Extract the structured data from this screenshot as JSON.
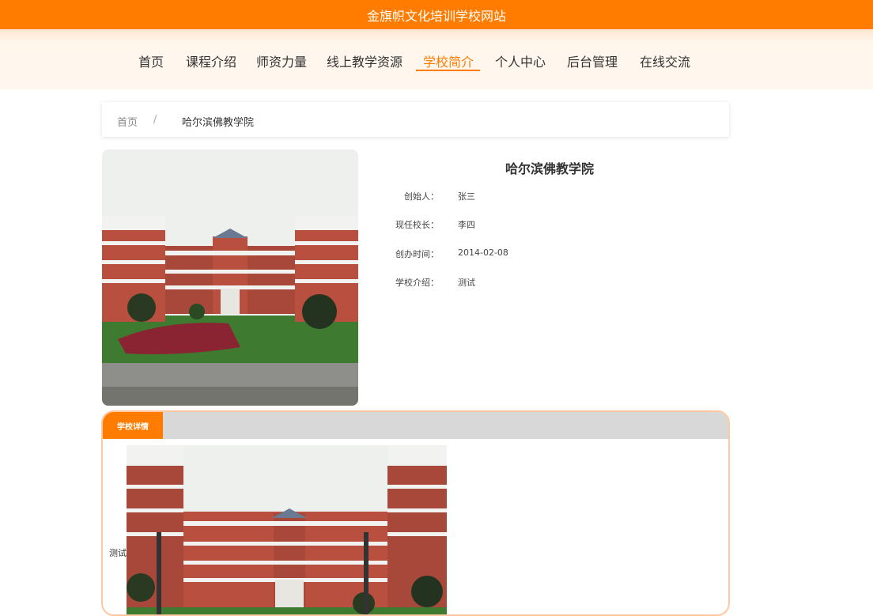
{
  "site": {
    "title": "金旗帜文化培训学校网站"
  },
  "nav": {
    "items": [
      {
        "label": "首页",
        "active": false
      },
      {
        "label": "课程介绍",
        "active": false
      },
      {
        "label": "师资力量",
        "active": false
      },
      {
        "label": "线上教学资源",
        "active": false
      },
      {
        "label": "学校简介",
        "active": true
      },
      {
        "label": "个人中心",
        "active": false
      },
      {
        "label": "后台管理",
        "active": false
      },
      {
        "label": "在线交流",
        "active": false
      }
    ]
  },
  "breadcrumb": {
    "home": "首页",
    "separator": "/",
    "current": "哈尔滨佛教学院"
  },
  "school": {
    "name": "哈尔滨佛教学院",
    "fields": [
      {
        "label": "创始人：",
        "value": "张三"
      },
      {
        "label": "现任校长：",
        "value": "李四"
      },
      {
        "label": "创办时间：",
        "value": "2014-02-08"
      },
      {
        "label": "学校介绍：",
        "value": "测试"
      }
    ]
  },
  "detail": {
    "tab_label": "学校详情",
    "text": "测试"
  },
  "colors": {
    "accent": "#ff7c00",
    "brick": "#a8483a",
    "sky": "#eef0ee",
    "lawn": "#3e7a30",
    "flower": "#8a2432"
  }
}
